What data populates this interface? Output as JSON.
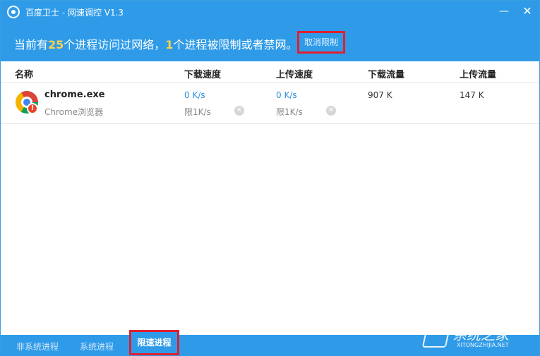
{
  "window": {
    "title": "百度卫士 - 网速调控 V1.3",
    "minimize": "—",
    "close": "✕"
  },
  "banner": {
    "prefix": "当前有",
    "process_count": "25",
    "middle": "个进程访问过网络，",
    "limited_count": "1",
    "suffix": "个进程被限制或者禁网。",
    "unlimit_button": "取消限制"
  },
  "table": {
    "columns": [
      "名称",
      "下载速度",
      "上传速度",
      "下载流量",
      "上传流量"
    ],
    "rows": [
      {
        "name": "chrome.exe",
        "description": "Chrome浏览器",
        "download_speed": "0 K/s",
        "download_limit": "限1K/s",
        "upload_speed": "0 K/s",
        "upload_limit": "限1K/s",
        "download_flow": "907 K",
        "upload_flow": "147 K",
        "icon": "chrome-icon",
        "badge": "!"
      }
    ]
  },
  "footer": {
    "tabs": [
      "非系统进程",
      "系统进程",
      "限速进程"
    ],
    "active_tab": "限速进程"
  },
  "watermark": {
    "main": "系统之家",
    "sub": "XITONGZHIJIA.NET"
  },
  "colors": {
    "accent": "#2f9be8",
    "highlight_number": "#ffd24a",
    "annotation_box": "#e0202e",
    "speed_text": "#2f8fd8"
  }
}
